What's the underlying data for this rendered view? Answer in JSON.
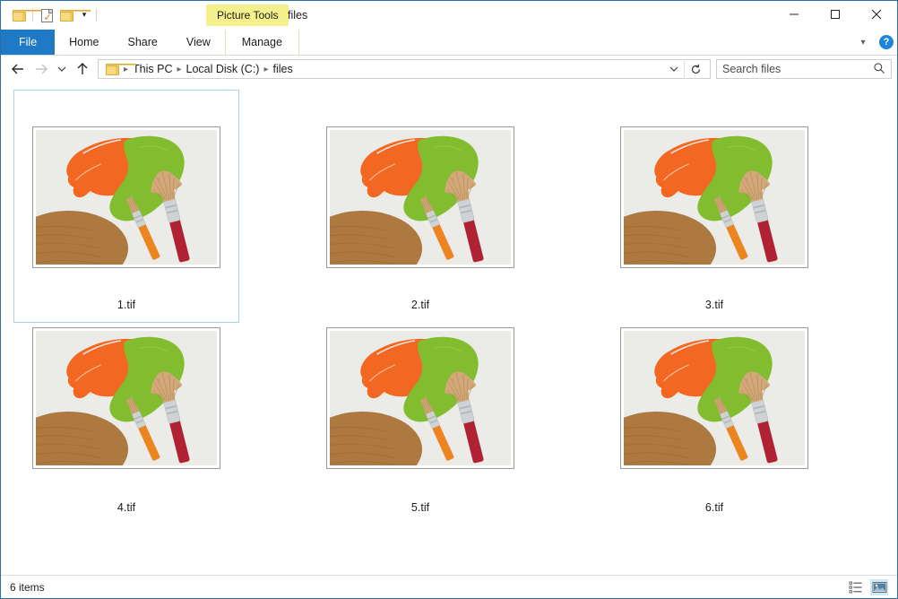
{
  "window": {
    "title": "files",
    "quick_access": [
      {
        "name": "folder-icon",
        "label": "Folder"
      },
      {
        "name": "properties-icon",
        "label": "Properties"
      },
      {
        "name": "new-folder-icon",
        "label": "New folder"
      },
      {
        "name": "customize-chevron-icon",
        "label": "Customize Quick Access Toolbar"
      }
    ],
    "controls": {
      "minimize": "Minimize",
      "maximize": "Maximize",
      "close": "Close"
    }
  },
  "contextual_tab": {
    "label": "Picture Tools",
    "color": "#f4f08c"
  },
  "ribbon": {
    "tabs": [
      {
        "label": "File",
        "active": true,
        "color": "#1e7ac4"
      },
      {
        "label": "Home",
        "active": false
      },
      {
        "label": "Share",
        "active": false
      },
      {
        "label": "View",
        "active": false
      },
      {
        "label": "Manage",
        "active": false,
        "contextual": true
      }
    ],
    "collapse_label": "Collapse the Ribbon",
    "help_label": "?"
  },
  "navigation": {
    "back_label": "Back",
    "forward_label": "Forward",
    "recent_label": "Recent locations",
    "up_label": "Up one level",
    "breadcrumb": [
      "This PC",
      "Local Disk (C:)",
      "files"
    ],
    "breadcrumb_dropdown_label": "Previous locations",
    "refresh_label": "Refresh"
  },
  "search": {
    "placeholder": "Search files",
    "value": "",
    "icon": "search-icon"
  },
  "files": [
    {
      "name": "1.tif",
      "selected": true
    },
    {
      "name": "2.tif",
      "selected": false
    },
    {
      "name": "3.tif",
      "selected": false
    },
    {
      "name": "4.tif",
      "selected": false
    },
    {
      "name": "5.tif",
      "selected": false
    },
    {
      "name": "6.tif",
      "selected": false
    }
  ],
  "artwork": {
    "background": "#ebebe7",
    "orange": "#f26722",
    "green": "#81bd2e",
    "wood": "#ae7940",
    "wood_dark": "#9a6632",
    "handle_red": "#b02232",
    "handle_orange": "#ee8420",
    "ferrule": "#cfd3d6",
    "bristle": "#d2a878"
  },
  "statusbar": {
    "item_count": "6 items",
    "views": [
      {
        "name": "details-view-button",
        "label": "Details view",
        "active": false
      },
      {
        "name": "large-icons-view-button",
        "label": "Large icons view",
        "active": true
      }
    ]
  }
}
